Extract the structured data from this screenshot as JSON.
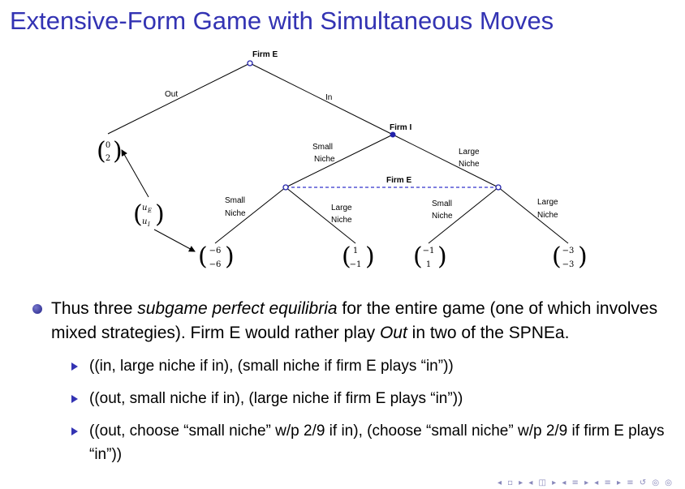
{
  "title": "Extensive-Form Game with Simultaneous Moves",
  "tree": {
    "root_label": "Firm E",
    "out_label": "Out",
    "in_label": "In",
    "firm_i_label": "Firm I",
    "firm_e_info_label": "Firm E",
    "small_niche": [
      "Small",
      "Niche"
    ],
    "large_niche": [
      "Large",
      "Niche"
    ],
    "payoff_out": [
      "0",
      "2"
    ],
    "legend": [
      "u",
      "E",
      "u",
      "I"
    ],
    "payoffs": [
      [
        "−6",
        "−6"
      ],
      [
        "1",
        "−1"
      ],
      [
        "−1",
        "1"
      ],
      [
        "−3",
        "−3"
      ]
    ],
    "colors": {
      "info_set": "#3333cc",
      "nodes": "#2222aa"
    }
  },
  "bullet": {
    "text_1": "Thus three ",
    "emph_1": "subgame perfect equilibria",
    "text_2": " for the entire game (one of which involves mixed strategies). Firm E would rather play ",
    "emph_2": "Out",
    "text_3": " in two of the SPNEa."
  },
  "sub_items": [
    "((in, large niche if in), (small niche if firm E plays “in”))",
    "((out, small niche if in), (large niche if firm E plays “in”))",
    "((out, choose “small niche” w/p 2/9 if in), (choose “small niche” w/p 2/9 if firm E plays “in”))"
  ],
  "nav_icons": "◂ ▫ ▸ ◂ ◫ ▸ ◂ ≡ ▸ ◂ ≡ ▸ ≡ ↺ ◎ ◎",
  "accent": "#3333b3"
}
